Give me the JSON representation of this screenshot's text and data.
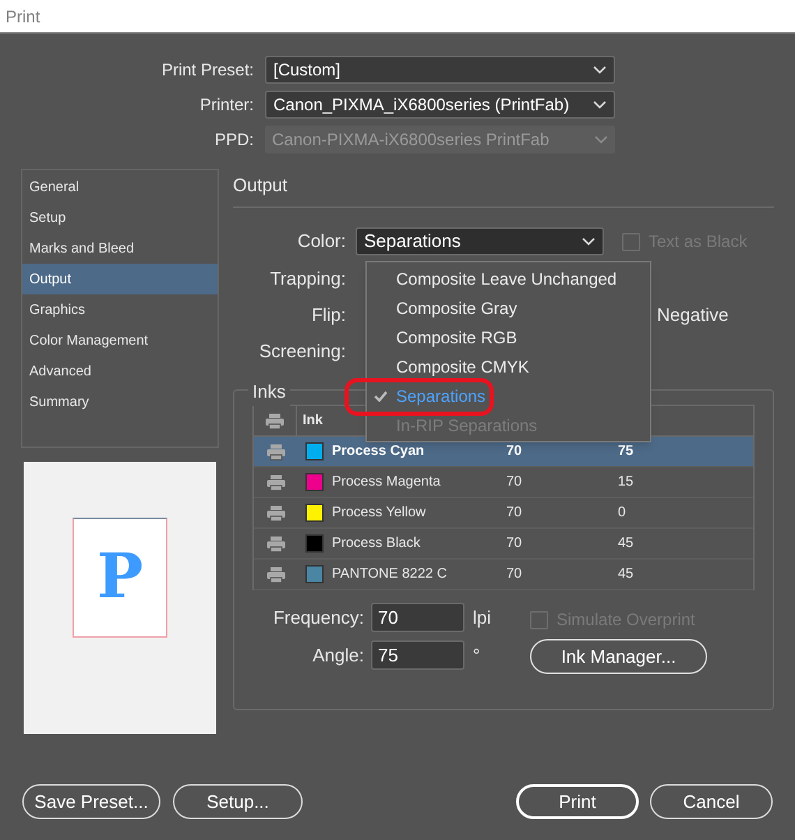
{
  "window": {
    "title": "Print"
  },
  "print_preset": {
    "label": "Print Preset:",
    "value": "[Custom]",
    "disabled": false
  },
  "printer": {
    "label": "Printer:",
    "value": "Canon_PIXMA_iX6800series (PrintFab)",
    "disabled": false
  },
  "ppd": {
    "label": "PPD:",
    "value": "Canon-PIXMA-iX6800series PrintFab",
    "disabled": true
  },
  "sidebar": {
    "items": [
      {
        "label": "General",
        "selected": false
      },
      {
        "label": "Setup",
        "selected": false
      },
      {
        "label": "Marks and Bleed",
        "selected": false
      },
      {
        "label": "Output",
        "selected": true
      },
      {
        "label": "Graphics",
        "selected": false
      },
      {
        "label": "Color Management",
        "selected": false
      },
      {
        "label": "Advanced",
        "selected": false
      },
      {
        "label": "Summary",
        "selected": false
      }
    ]
  },
  "preview": {
    "letter": "P"
  },
  "output": {
    "heading": "Output",
    "color": {
      "label": "Color:",
      "value": "Separations"
    },
    "text_as_black": {
      "label": "Text as Black",
      "checked": false,
      "disabled": true
    },
    "trapping_label": "Trapping:",
    "flip_label": "Flip:",
    "negative_label": "Negative",
    "screening_label": "Screening:"
  },
  "color_menu": {
    "items": [
      {
        "label": "Composite Leave Unchanged",
        "selected": false,
        "disabled": false
      },
      {
        "label": "Composite Gray",
        "selected": false,
        "disabled": false
      },
      {
        "label": "Composite RGB",
        "selected": false,
        "disabled": false
      },
      {
        "label": "Composite CMYK",
        "selected": false,
        "disabled": false
      },
      {
        "label": "Separations",
        "selected": true,
        "disabled": false
      },
      {
        "label": "In-RIP Separations",
        "selected": false,
        "disabled": true
      }
    ]
  },
  "inks": {
    "title": "Inks",
    "columns": [
      "Ink"
    ],
    "rows": [
      {
        "name": "Process Cyan",
        "color": "#00aeef",
        "frequency": "70",
        "angle": "75",
        "selected": true
      },
      {
        "name": "Process Magenta",
        "color": "#ec008c",
        "frequency": "70",
        "angle": "15",
        "selected": false
      },
      {
        "name": "Process Yellow",
        "color": "#fff200",
        "frequency": "70",
        "angle": "0",
        "selected": false
      },
      {
        "name": "Process Black",
        "color": "#000000",
        "frequency": "70",
        "angle": "45",
        "selected": false
      },
      {
        "name": "PANTONE 8222 C",
        "color": "#4a85a3",
        "frequency": "70",
        "angle": "45",
        "selected": false
      }
    ],
    "frequency": {
      "label": "Frequency:",
      "value": "70",
      "unit": "lpi"
    },
    "angle": {
      "label": "Angle:",
      "value": "75",
      "unit": "°"
    },
    "simulate_overprint": {
      "label": "Simulate Overprint",
      "checked": false,
      "disabled": true
    },
    "ink_manager": "Ink Manager..."
  },
  "buttons": [
    {
      "label": "Save Preset...",
      "primary": false
    },
    {
      "label": "Setup...",
      "primary": false
    },
    {
      "label": "Print",
      "primary": true
    },
    {
      "label": "Cancel",
      "primary": false
    }
  ]
}
